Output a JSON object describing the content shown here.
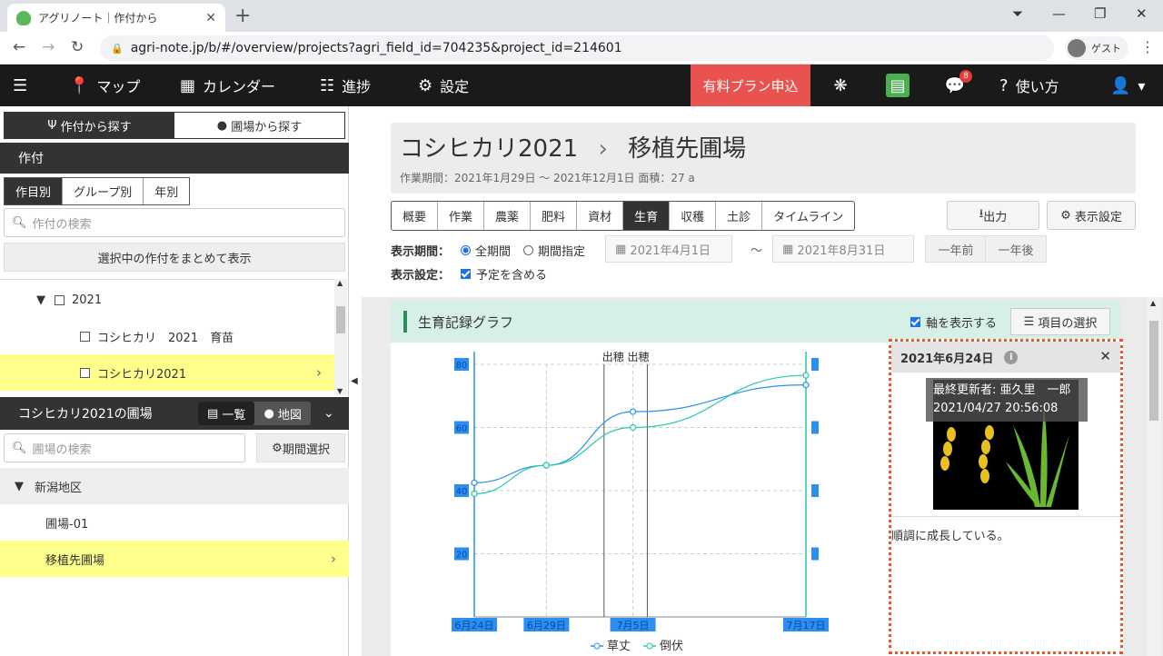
{
  "browser": {
    "tab_title": "アグリノート｜作付から",
    "url": "agri-note.jp/b/#/overview/projects?agri_field_id=704235&project_id=214601",
    "profile": "ゲスト"
  },
  "appnav": {
    "map": "マップ",
    "calendar": "カレンダー",
    "progress": "進捗",
    "settings": "設定",
    "paid_plan": "有料プラン申込",
    "notify_count": "8",
    "help": "使い方"
  },
  "sidebar": {
    "search_by_crop": "作付から探す",
    "search_by_field": "圃場から探す",
    "crop_header": "作付",
    "group_tabs": [
      "作目別",
      "グループ別",
      "年別"
    ],
    "crop_search_placeholder": "作付の検索",
    "show_selected": "選択中の作付をまとめて表示",
    "tree": [
      {
        "label": "2021"
      },
      {
        "label": "コシヒカリ　2021　育苗"
      },
      {
        "label": "コシヒカリ2021"
      }
    ],
    "fields_header": "コシヒカリ2021の圃場",
    "list_label": "一覧",
    "map_label": "地図",
    "field_search_placeholder": "圃場の検索",
    "period_select": "期間選択",
    "field_group": "新潟地区",
    "fields": [
      "圃場-01",
      "移植先圃場"
    ]
  },
  "main": {
    "title_crop": "コシヒカリ2021",
    "title_field": "移植先圃場",
    "subtitle": "作業期間：2021年1月29日 ～ 2021年12月1日  面積：27 a",
    "tabs": [
      "概要",
      "作業",
      "農薬",
      "肥料",
      "資材",
      "生育",
      "収穫",
      "土診",
      "タイムライン"
    ],
    "active_tab": "生育",
    "export": "出力",
    "display_settings": "表示設定",
    "period_label": "表示期間：",
    "all_period": "全期間",
    "specify_period": "期間指定",
    "date_from": "2021年4月1日",
    "date_to": "2021年8月31日",
    "tilde": "～",
    "prev_year": "一年前",
    "next_year": "一年後",
    "display_label": "表示設定：",
    "include_planned": "予定を含める",
    "graph_title": "生育記録グラフ",
    "show_axis": "軸を表示する",
    "select_items": "項目の選択"
  },
  "chart_data": {
    "type": "line",
    "title": "",
    "annotation": "出穂 出穂",
    "x": [
      "6月24日",
      "6月29日",
      "7月5日",
      "7月17日"
    ],
    "x_days": [
      0,
      5,
      11,
      23
    ],
    "heading_days": [
      9,
      12
    ],
    "yticks": [
      20,
      40,
      60,
      80
    ],
    "ylim": [
      0,
      80
    ],
    "series": [
      {
        "name": "草丈",
        "values": [
          42.5,
          48,
          65,
          73.5
        ],
        "color": "#2a8ff0"
      },
      {
        "name": "倒伏",
        "values": [
          39,
          48,
          60,
          76.5
        ],
        "color": "#25c9a8"
      }
    ]
  },
  "popup": {
    "date": "2021年6月24日",
    "updater": "最終更新者: 亜久里　一郎",
    "updated_at": "2021/04/27 20:56:08",
    "memo": "順調に成長している。",
    "colors": {
      "border": "#e8572a"
    }
  }
}
